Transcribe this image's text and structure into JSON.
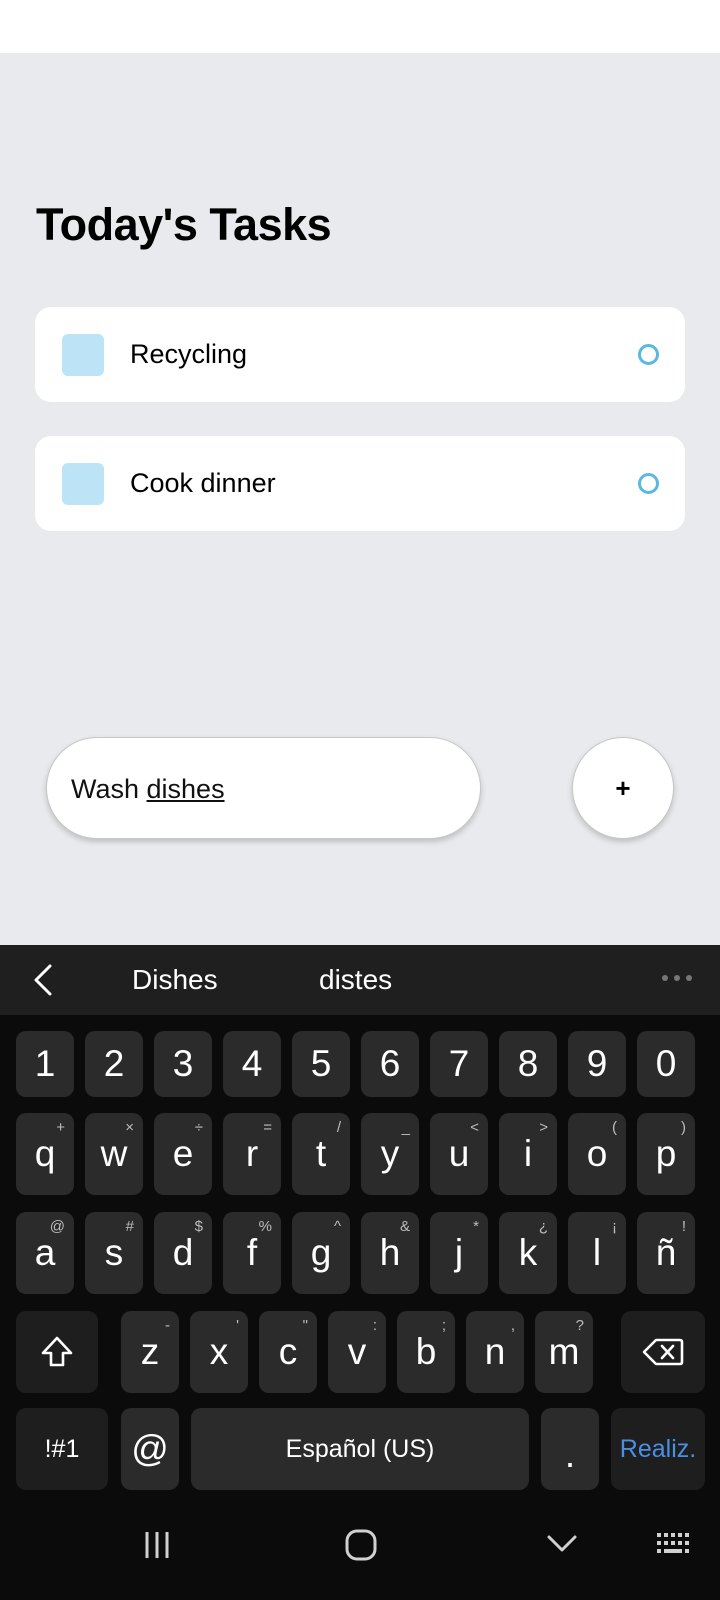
{
  "app": {
    "title": "Today's Tasks",
    "tasks": [
      {
        "label": "Recycling"
      },
      {
        "label": "Cook dinner"
      }
    ],
    "input": {
      "value_plain": "Wash ",
      "value_underlined": "dishes"
    },
    "add_button_label": "+"
  },
  "keyboard": {
    "suggestions": [
      "Dishes",
      "distes"
    ],
    "number_row": [
      "1",
      "2",
      "3",
      "4",
      "5",
      "6",
      "7",
      "8",
      "9",
      "0"
    ],
    "row1": [
      {
        "key": "q",
        "hint": "+"
      },
      {
        "key": "w",
        "hint": "×"
      },
      {
        "key": "e",
        "hint": "÷"
      },
      {
        "key": "r",
        "hint": "="
      },
      {
        "key": "t",
        "hint": "/"
      },
      {
        "key": "y",
        "hint": "_"
      },
      {
        "key": "u",
        "hint": "<"
      },
      {
        "key": "i",
        "hint": ">"
      },
      {
        "key": "o",
        "hint": "("
      },
      {
        "key": "p",
        "hint": ")"
      }
    ],
    "row2": [
      {
        "key": "a",
        "hint": "@"
      },
      {
        "key": "s",
        "hint": "#"
      },
      {
        "key": "d",
        "hint": "$"
      },
      {
        "key": "f",
        "hint": "%"
      },
      {
        "key": "g",
        "hint": "^"
      },
      {
        "key": "h",
        "hint": "&"
      },
      {
        "key": "j",
        "hint": "*"
      },
      {
        "key": "k",
        "hint": "¿"
      },
      {
        "key": "l",
        "hint": "¡"
      },
      {
        "key": "ñ",
        "hint": "!"
      }
    ],
    "row3": [
      {
        "key": "z",
        "hint": "-"
      },
      {
        "key": "x",
        "hint": "'"
      },
      {
        "key": "c",
        "hint": "\""
      },
      {
        "key": "v",
        "hint": ":"
      },
      {
        "key": "b",
        "hint": ";"
      },
      {
        "key": "n",
        "hint": ","
      },
      {
        "key": "m",
        "hint": "?"
      }
    ],
    "symbols_label": "!#1",
    "at_label": "@",
    "space_label": "Español (US)",
    "period_label": ".",
    "done_label": "Realiz.",
    "colors": {
      "accent": "#4a90e2",
      "task_square": "#bde3f7",
      "task_circle": "#5bb8e0"
    }
  }
}
